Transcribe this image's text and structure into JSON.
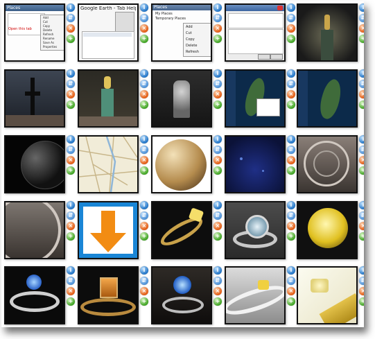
{
  "colors": {
    "page_background": "#ffffff",
    "thumb_border": "#111111",
    "info_icon": "#1f73c6",
    "move_icon": "#4a8fd6",
    "delete_icon": "#e35b12",
    "add_icon": "#3ea321",
    "highlight_orange": "#f28c13"
  },
  "icon_set": [
    "info-icon",
    "move-icon",
    "delete-icon",
    "add-icon"
  ],
  "thumbnails": [
    {
      "name": "places-panel-screenshot",
      "caption": "Places",
      "items": [
        "Add",
        "Cut",
        "Copy",
        "Delete",
        "Refresh",
        "Rename",
        "Save As",
        "Properties"
      ],
      "note": "Open this tab"
    },
    {
      "name": "google-earth-help-screenshot",
      "caption": "Google Earth - Tab Help"
    },
    {
      "name": "context-menu-screenshot",
      "caption": "Places",
      "tree": [
        "My Places",
        "Temporary Places"
      ],
      "items": [
        "Add",
        "Cut",
        "Copy",
        "Delete",
        "Refresh"
      ]
    },
    {
      "name": "properties-dialog-screenshot",
      "caption": ""
    },
    {
      "name": "statue-of-liberty-torch-dark"
    },
    {
      "name": "tower-silhouette-dark"
    },
    {
      "name": "statue-of-liberty-torch-green"
    },
    {
      "name": "statue-of-liberty-gray"
    },
    {
      "name": "map-view-taiwan-popup"
    },
    {
      "name": "map-view-taiwan"
    },
    {
      "name": "dark-sphere-render"
    },
    {
      "name": "city-street-map"
    },
    {
      "name": "textured-planet-sphere"
    },
    {
      "name": "night-sky-globe"
    },
    {
      "name": "ferris-wheel-photo"
    },
    {
      "name": "ferris-wheel-closeup"
    },
    {
      "name": "download-arrow-icon-thumbnail"
    },
    {
      "name": "gold-ring-yellow-diamond"
    },
    {
      "name": "silver-ring-round-diamond"
    },
    {
      "name": "yellow-diamond-closeup"
    },
    {
      "name": "blue-diamond-ring"
    },
    {
      "name": "gold-ring-orange-stone"
    },
    {
      "name": "blue-diamond-ring-closeup"
    },
    {
      "name": "white-gold-ring-yellow-stone"
    },
    {
      "name": "yellow-diamond-engraved"
    }
  ]
}
